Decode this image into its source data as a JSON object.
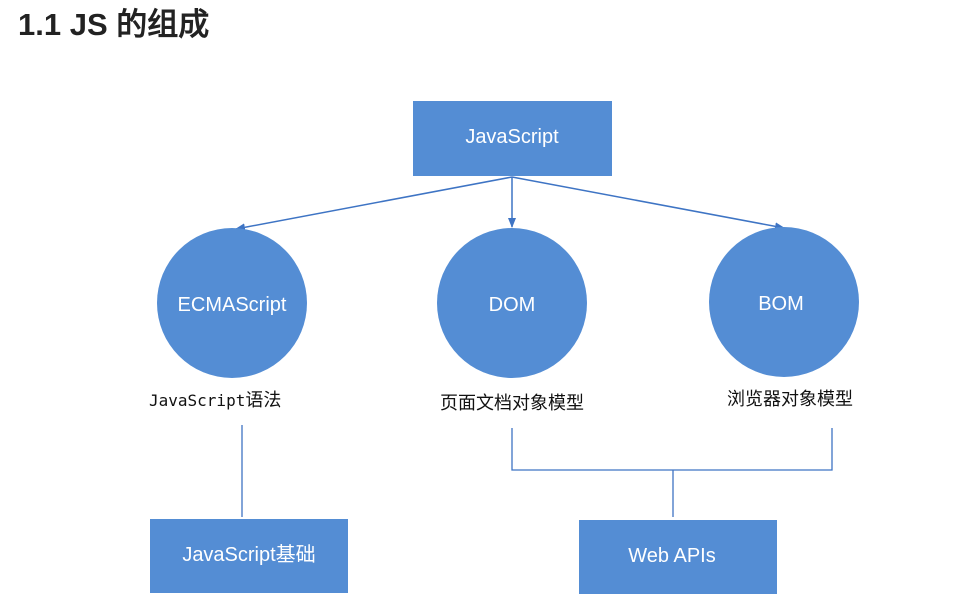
{
  "title": "1.1 JS 的组成",
  "colors": {
    "node_fill": "#548dd4",
    "connector": "#3e74c4",
    "text_dark": "#111111",
    "title_color": "#222222"
  },
  "diagram": {
    "root": {
      "label": "JavaScript"
    },
    "parts": [
      {
        "label": "ECMAScript",
        "caption_mono": "JavaScript",
        "caption_cjk": "语法"
      },
      {
        "label": "DOM",
        "caption": "页面文档对象模型"
      },
      {
        "label": "BOM",
        "caption": "浏览器对象模型"
      }
    ],
    "groups": [
      {
        "label": "JavaScript基础"
      },
      {
        "label": "Web APIs"
      }
    ]
  }
}
